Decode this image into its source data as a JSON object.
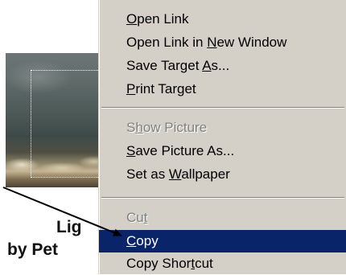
{
  "page": {
    "caption_line1": "Lig",
    "caption_line2": "by Pet"
  },
  "context_menu": {
    "items": [
      {
        "pre": "",
        "key": "O",
        "post": "pen Link",
        "disabled": false,
        "selected": false
      },
      {
        "pre": "Open Link in ",
        "key": "N",
        "post": "ew Window",
        "disabled": false,
        "selected": false
      },
      {
        "pre": "Save Target ",
        "key": "A",
        "post": "s...",
        "disabled": false,
        "selected": false
      },
      {
        "pre": "",
        "key": "P",
        "post": "rint Target",
        "disabled": false,
        "selected": false
      },
      {
        "pre": "S",
        "key": "h",
        "post": "ow Picture",
        "disabled": true,
        "selected": false
      },
      {
        "pre": "",
        "key": "S",
        "post": "ave Picture As...",
        "disabled": false,
        "selected": false
      },
      {
        "pre": "Set as ",
        "key": "W",
        "post": "allpaper",
        "disabled": false,
        "selected": false
      },
      {
        "pre": "Cu",
        "key": "t",
        "post": "",
        "disabled": true,
        "selected": false
      },
      {
        "pre": "",
        "key": "C",
        "post": "opy",
        "disabled": false,
        "selected": true
      },
      {
        "pre": "Copy Shor",
        "key": "t",
        "post": "cut",
        "disabled": false,
        "selected": false
      }
    ]
  },
  "colors": {
    "menu_background": "#d4d0c8",
    "highlight": "#0a246a",
    "disabled_text": "#808080"
  }
}
